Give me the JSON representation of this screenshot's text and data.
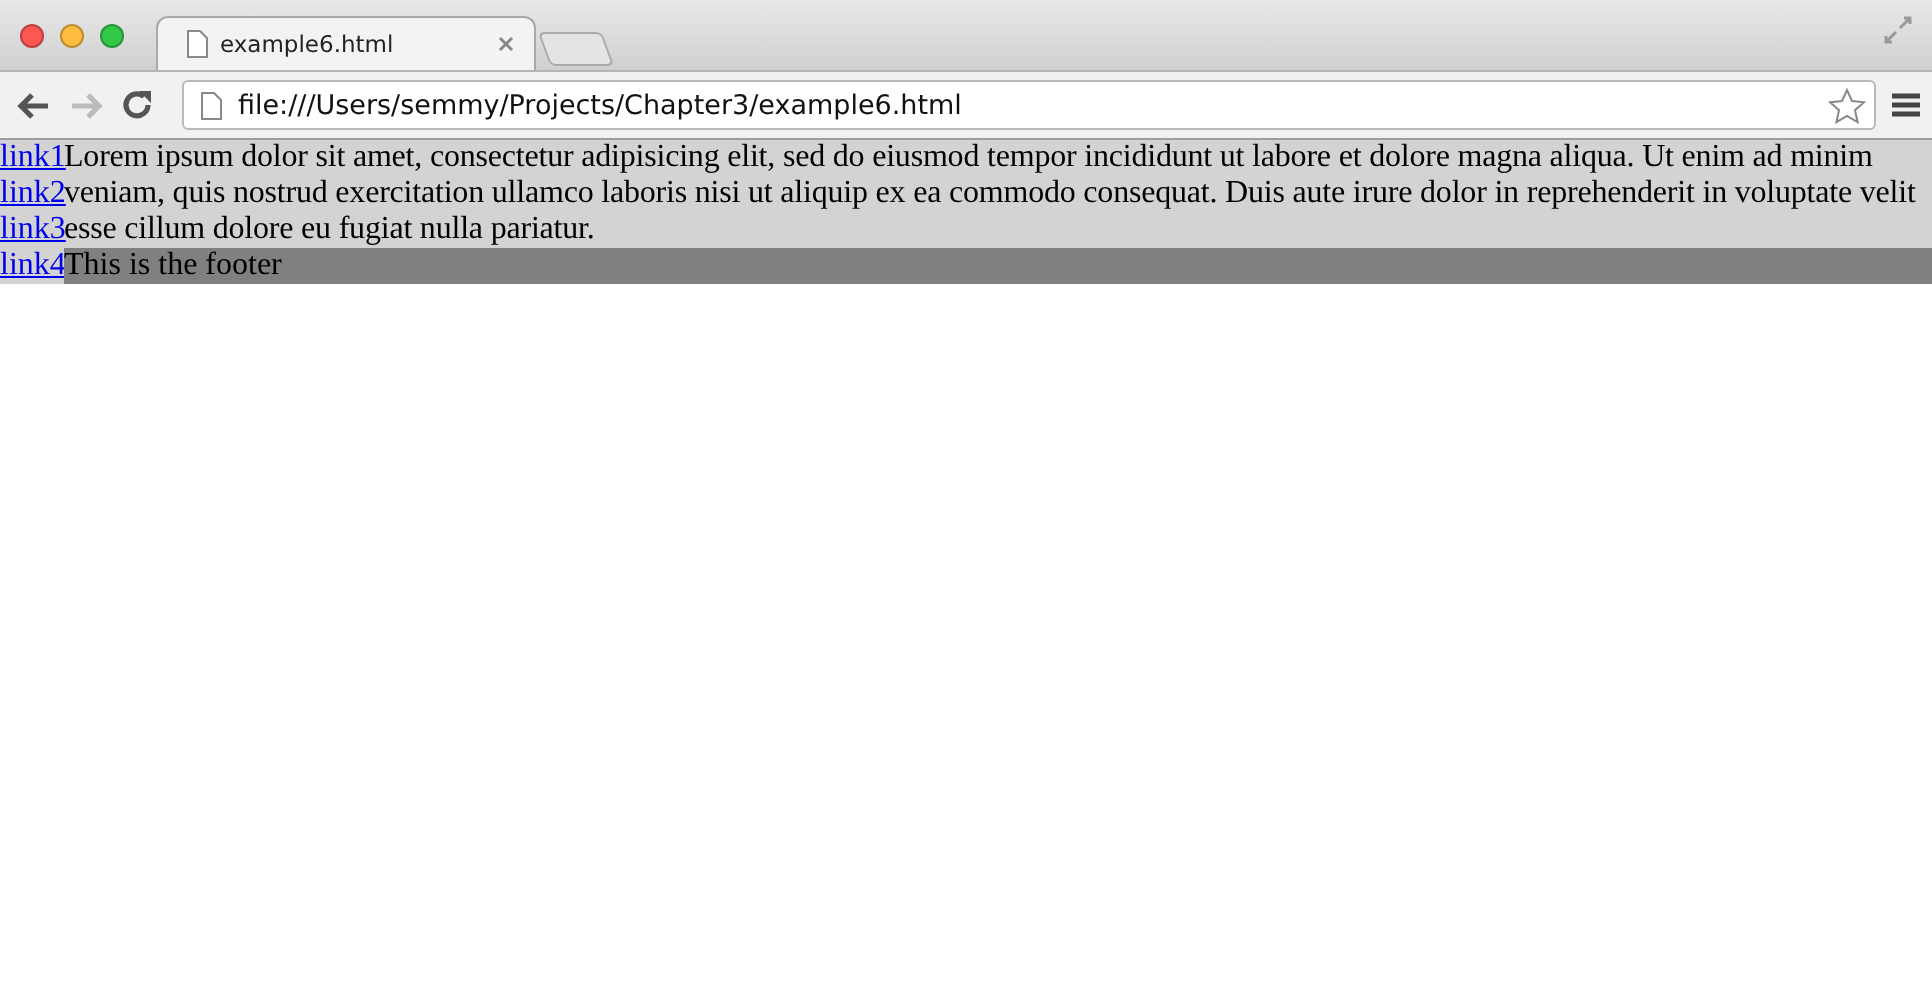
{
  "browser": {
    "tabs": [
      {
        "title": "example6.html",
        "selected": true
      }
    ],
    "address": "file:///Users/semmy/Projects/Chapter3/example6.html"
  },
  "page": {
    "nav_links": [
      "link1",
      "link2",
      "link3",
      "link4"
    ],
    "paragraph": "Lorem ipsum dolor sit amet, consectetur adipisicing elit, sed do eiusmod tempor incididunt ut labore et dolore magna aliqua. Ut enim ad minim veniam, quis nostrud exercitation ullamco laboris nisi ut aliquip ex ea commodo consequat. Duis aute irure dolor in reprehenderit in voluptate velit esse cillum dolore eu fugiat nulla pariatur.",
    "footer": "This is the footer"
  }
}
